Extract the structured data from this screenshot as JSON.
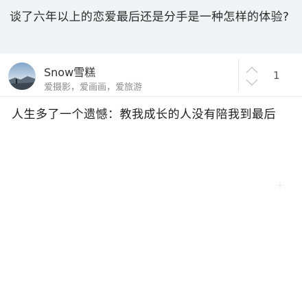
{
  "question": {
    "title": "谈了六年以上的恋爱最后还是分手是一种怎样的体验?"
  },
  "author": {
    "name": "Snow雪糕",
    "bio": "爱摄影，爱画画，爱旅游",
    "avatar_icon": "avatar-landscape-photo"
  },
  "vote": {
    "icon": "vote-up-down-icon",
    "count": "1"
  },
  "answer": {
    "text": "人生多了一个遗憾：教我成长的人没有陪我到最后"
  },
  "colors": {
    "header_bg": "#f2f3f7",
    "text_primary": "#222222",
    "text_secondary": "#8c8c8c",
    "divider": "#e9e9e9"
  }
}
